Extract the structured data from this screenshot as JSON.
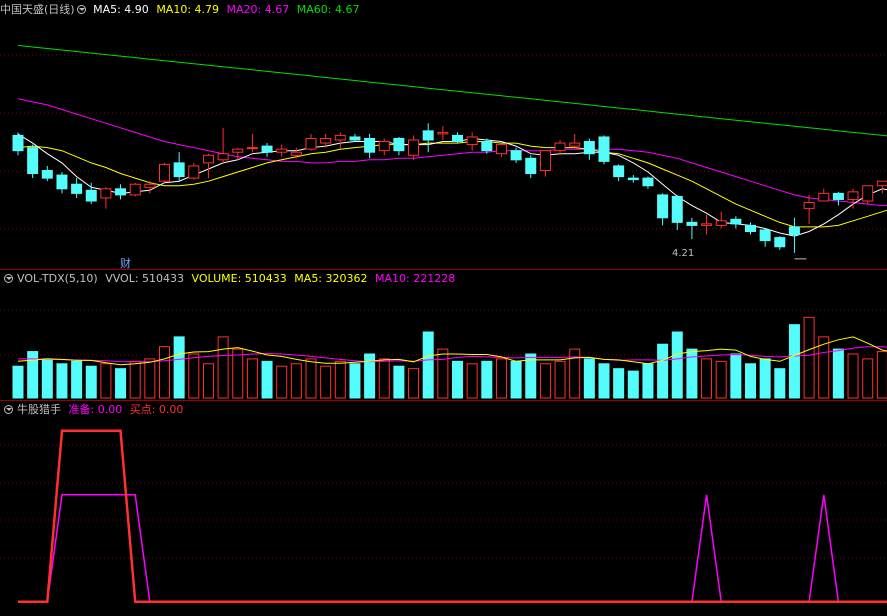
{
  "price_panel": {
    "title": "中国天盛(日线)",
    "indicators": [
      {
        "label": "MA5: 4.90",
        "color": "#ffffff"
      },
      {
        "label": "MA10: 4.79",
        "color": "#ffff00"
      },
      {
        "label": "MA20: 4.67",
        "color": "#ff00ff"
      },
      {
        "label": "MA60: 4.67",
        "color": "#00e000"
      }
    ],
    "finance_marker": "财",
    "low_label": "4.21"
  },
  "volume_panel": {
    "title": "VOL-TDX(5,10)",
    "indicators": [
      {
        "label": "VVOL: 510433",
        "color": "#c0c0c0"
      },
      {
        "label": "VOLUME: 510433",
        "color": "#ffff00"
      },
      {
        "label": "MA5: 320362",
        "color": "#ffff00"
      },
      {
        "label": "MA10: 221228",
        "color": "#ff00ff"
      }
    ]
  },
  "signal_panel": {
    "title": "牛股猎手",
    "indicators": [
      {
        "label": "准备: 0.00",
        "color": "#ff00ff"
      },
      {
        "label": "买点: 0.00",
        "color": "#ff3030"
      }
    ]
  },
  "colors": {
    "up": "#ff3030",
    "down": "#54fcfc",
    "grid": "#7a0000",
    "ma5": "#ffffff",
    "ma10": "#ffff00",
    "ma20": "#ff00ff",
    "ma60": "#00e000"
  },
  "chart_data": [
    {
      "type": "candlestick",
      "title": "中国天盛(日线)",
      "ohlc": [
        [
          4.98,
          5.0,
          4.85,
          4.88
        ],
        [
          4.9,
          4.92,
          4.7,
          4.73
        ],
        [
          4.75,
          4.78,
          4.68,
          4.7
        ],
        [
          4.72,
          4.74,
          4.6,
          4.63
        ],
        [
          4.66,
          4.7,
          4.57,
          4.6
        ],
        [
          4.62,
          4.67,
          4.53,
          4.55
        ],
        [
          4.57,
          4.64,
          4.5,
          4.63
        ],
        [
          4.63,
          4.66,
          4.56,
          4.59
        ],
        [
          4.59,
          4.67,
          4.58,
          4.66
        ],
        [
          4.64,
          4.68,
          4.6,
          4.66
        ],
        [
          4.68,
          4.8,
          4.67,
          4.79
        ],
        [
          4.8,
          4.87,
          4.68,
          4.71
        ],
        [
          4.7,
          4.8,
          4.69,
          4.78
        ],
        [
          4.8,
          4.86,
          4.7,
          4.85
        ],
        [
          4.82,
          5.03,
          4.8,
          4.86
        ],
        [
          4.87,
          4.9,
          4.82,
          4.89
        ],
        [
          4.9,
          4.99,
          4.87,
          4.9
        ],
        [
          4.91,
          4.93,
          4.84,
          4.87
        ],
        [
          4.87,
          4.92,
          4.84,
          4.89
        ],
        [
          4.85,
          4.9,
          4.83,
          4.87
        ],
        [
          4.89,
          4.99,
          4.88,
          4.96
        ],
        [
          4.93,
          4.99,
          4.9,
          4.96
        ],
        [
          4.95,
          5.0,
          4.89,
          4.98
        ],
        [
          4.97,
          4.99,
          4.94,
          4.95
        ],
        [
          4.96,
          4.99,
          4.83,
          4.87
        ],
        [
          4.88,
          4.96,
          4.85,
          4.94
        ],
        [
          4.96,
          4.97,
          4.85,
          4.88
        ],
        [
          4.85,
          4.98,
          4.82,
          4.95
        ],
        [
          5.01,
          5.06,
          4.87,
          4.95
        ],
        [
          4.99,
          5.04,
          4.95,
          5.0
        ],
        [
          4.98,
          5.0,
          4.93,
          4.94
        ],
        [
          4.92,
          5.0,
          4.88,
          4.97
        ],
        [
          4.94,
          4.96,
          4.86,
          4.88
        ],
        [
          4.86,
          4.92,
          4.84,
          4.92
        ],
        [
          4.88,
          4.9,
          4.8,
          4.82
        ],
        [
          4.83,
          4.85,
          4.7,
          4.73
        ],
        [
          4.75,
          4.88,
          4.71,
          4.88
        ],
        [
          4.88,
          4.95,
          4.85,
          4.93
        ],
        [
          4.91,
          4.99,
          4.9,
          4.93
        ],
        [
          4.94,
          4.96,
          4.82,
          4.86
        ],
        [
          4.97,
          4.98,
          4.79,
          4.81
        ],
        [
          4.78,
          4.79,
          4.68,
          4.71
        ],
        [
          4.7,
          4.72,
          4.67,
          4.69
        ],
        [
          4.7,
          4.71,
          4.63,
          4.65
        ],
        [
          4.59,
          4.6,
          4.39,
          4.44
        ],
        [
          4.58,
          4.59,
          4.36,
          4.41
        ],
        [
          4.41,
          4.44,
          4.3,
          4.39
        ],
        [
          4.39,
          4.46,
          4.33,
          4.4
        ],
        [
          4.39,
          4.48,
          4.37,
          4.42
        ],
        [
          4.43,
          4.45,
          4.37,
          4.4
        ],
        [
          4.39,
          4.41,
          4.33,
          4.35
        ],
        [
          4.36,
          4.37,
          4.25,
          4.29
        ],
        [
          4.31,
          4.32,
          4.23,
          4.25
        ],
        [
          4.38,
          4.44,
          4.21,
          4.33
        ],
        [
          4.5,
          4.59,
          4.4,
          4.54
        ],
        [
          4.55,
          4.63,
          4.55,
          4.6
        ],
        [
          4.6,
          4.61,
          4.52,
          4.56
        ],
        [
          4.56,
          4.63,
          4.5,
          4.61
        ],
        [
          4.55,
          4.65,
          4.53,
          4.65
        ],
        [
          4.65,
          4.68,
          4.6,
          4.68
        ],
        [
          4.67,
          4.69,
          4.55,
          4.55
        ],
        [
          4.56,
          4.62,
          4.53,
          4.6
        ],
        [
          4.59,
          4.61,
          4.56,
          4.57
        ],
        [
          4.55,
          4.62,
          4.53,
          4.6
        ],
        [
          4.58,
          4.63,
          4.57,
          4.62
        ],
        [
          4.62,
          4.65,
          4.58,
          4.6
        ],
        [
          4.61,
          4.63,
          4.54,
          4.63
        ],
        [
          4.6,
          4.66,
          4.58,
          4.63
        ],
        [
          4.63,
          4.65,
          4.56,
          4.56
        ],
        [
          4.56,
          4.64,
          4.55,
          4.63
        ],
        [
          4.63,
          4.66,
          4.58,
          4.59
        ],
        [
          4.58,
          4.64,
          4.55,
          4.64
        ],
        [
          4.64,
          4.66,
          4.58,
          4.62
        ],
        [
          4.62,
          4.65,
          4.55,
          4.58
        ]
      ],
      "ma5": [
        4.99,
        4.93,
        4.86,
        4.8,
        4.71,
        4.64,
        4.62,
        4.6,
        4.61,
        4.62,
        4.67,
        4.68,
        4.72,
        4.76,
        4.8,
        4.82,
        4.86,
        4.87,
        4.88,
        4.88,
        4.9,
        4.91,
        4.93,
        4.94,
        4.94,
        4.94,
        4.92,
        4.92,
        4.92,
        4.94,
        4.94,
        4.96,
        4.95,
        4.94,
        4.91,
        4.86,
        4.85,
        4.86,
        4.86,
        4.87,
        4.87,
        4.85,
        4.8,
        4.74,
        4.66,
        4.58,
        4.52,
        4.47,
        4.41,
        4.4,
        4.39,
        4.37,
        4.34,
        4.32,
        4.35,
        4.4,
        4.46,
        4.53,
        4.59,
        4.63,
        4.61,
        4.6,
        4.59,
        4.6,
        4.59,
        4.6,
        4.6,
        4.61,
        4.61,
        4.61,
        4.61,
        4.61,
        4.61,
        4.61
      ],
      "ma10": [
        4.9,
        4.91,
        4.9,
        4.88,
        4.84,
        4.8,
        4.77,
        4.73,
        4.7,
        4.67,
        4.65,
        4.65,
        4.66,
        4.68,
        4.71,
        4.74,
        4.77,
        4.8,
        4.82,
        4.84,
        4.86,
        4.87,
        4.89,
        4.9,
        4.91,
        4.92,
        4.92,
        4.92,
        4.93,
        4.93,
        4.93,
        4.94,
        4.94,
        4.93,
        4.93,
        4.91,
        4.9,
        4.9,
        4.9,
        4.89,
        4.87,
        4.86,
        4.83,
        4.8,
        4.76,
        4.72,
        4.68,
        4.63,
        4.58,
        4.53,
        4.49,
        4.45,
        4.41,
        4.38,
        4.38,
        4.38,
        4.39,
        4.42,
        4.45,
        4.48,
        4.51,
        4.53,
        4.56,
        4.58,
        4.59,
        4.6,
        4.6,
        4.6,
        4.6,
        4.6,
        4.61,
        4.61,
        4.61,
        4.61
      ],
      "ma20": [
        5.22,
        5.2,
        5.18,
        5.15,
        5.12,
        5.09,
        5.06,
        5.03,
        5.0,
        4.97,
        4.94,
        4.92,
        4.9,
        4.88,
        4.86,
        4.84,
        4.83,
        4.82,
        4.81,
        4.81,
        4.8,
        4.8,
        4.81,
        4.81,
        4.82,
        4.82,
        4.83,
        4.83,
        4.84,
        4.85,
        4.86,
        4.87,
        4.87,
        4.88,
        4.88,
        4.88,
        4.88,
        4.89,
        4.89,
        4.89,
        4.89,
        4.89,
        4.88,
        4.87,
        4.85,
        4.83,
        4.8,
        4.77,
        4.74,
        4.71,
        4.68,
        4.65,
        4.62,
        4.59,
        4.57,
        4.56,
        4.55,
        4.54,
        4.53,
        4.52,
        4.52,
        4.51,
        4.51,
        4.51,
        4.51,
        4.51,
        4.51,
        4.51,
        4.52,
        4.52,
        4.52,
        4.53,
        4.54,
        4.54
      ],
      "ma60": [
        5.57,
        5.56,
        5.55,
        5.54,
        5.53,
        5.52,
        5.51,
        5.5,
        5.49,
        5.48,
        5.47,
        5.46,
        5.45,
        5.44,
        5.43,
        5.42,
        5.41,
        5.4,
        5.39,
        5.38,
        5.37,
        5.36,
        5.35,
        5.34,
        5.33,
        5.32,
        5.31,
        5.3,
        5.29,
        5.28,
        5.27,
        5.26,
        5.25,
        5.24,
        5.23,
        5.22,
        5.21,
        5.2,
        5.19,
        5.18,
        5.17,
        5.16,
        5.15,
        5.14,
        5.13,
        5.12,
        5.11,
        5.1,
        5.09,
        5.08,
        5.07,
        5.06,
        5.05,
        5.04,
        5.03,
        5.02,
        5.01,
        5.0,
        4.99,
        4.98,
        4.97,
        4.96,
        4.95,
        4.94,
        4.93,
        4.92,
        4.91,
        4.9,
        4.89,
        4.88,
        4.87,
        4.86,
        4.85,
        4.84
      ],
      "ylim": [
        4.15,
        5.75
      ],
      "low_point": {
        "index": 53,
        "value": 4.21
      },
      "finance_marker_index": 10
    },
    {
      "type": "bar",
      "title": "VOL-TDX(5,10)",
      "volume": [
        130000,
        190000,
        160000,
        140000,
        150000,
        130000,
        140000,
        120000,
        150000,
        160000,
        210000,
        250000,
        180000,
        140000,
        250000,
        200000,
        160000,
        150000,
        130000,
        140000,
        160000,
        130000,
        150000,
        140000,
        180000,
        160000,
        130000,
        120000,
        270000,
        200000,
        150000,
        140000,
        150000,
        160000,
        150000,
        180000,
        140000,
        150000,
        200000,
        160000,
        140000,
        120000,
        110000,
        140000,
        220000,
        270000,
        200000,
        160000,
        150000,
        180000,
        140000,
        160000,
        120000,
        300000,
        330000,
        250000,
        200000,
        180000,
        160000,
        190000,
        200000,
        170000,
        150000,
        130000,
        160000,
        150000,
        140000,
        150000,
        160000,
        150000,
        140000,
        130000,
        120000,
        130000
      ],
      "ma5": [
        150000,
        155000,
        160000,
        158000,
        154000,
        154000,
        144000,
        136000,
        140000,
        146000,
        160000,
        180000,
        188000,
        190000,
        200000,
        206000,
        192000,
        176000,
        170000,
        158000,
        148000,
        142000,
        142000,
        146000,
        150000,
        156000,
        158000,
        148000,
        172000,
        180000,
        180000,
        178000,
        178000,
        168000,
        150000,
        156000,
        156000,
        156000,
        164000,
        166000,
        158000,
        156000,
        148000,
        140000,
        154000,
        180000,
        190000,
        194000,
        200000,
        196000,
        170000,
        158000,
        150000,
        174000,
        198000,
        220000,
        238000,
        250000,
        224000,
        196000,
        186000,
        182000,
        176000,
        166000,
        160000,
        156000,
        150000,
        146000,
        150000,
        152000,
        150000,
        146000,
        142000,
        138000
      ],
      "ma10": [
        160000,
        160000,
        158000,
        157000,
        156000,
        154000,
        152000,
        149000,
        148000,
        148000,
        152000,
        158000,
        165000,
        170000,
        174000,
        176000,
        180000,
        182000,
        180000,
        176000,
        170000,
        164000,
        158000,
        152000,
        149000,
        150000,
        152000,
        150000,
        156000,
        158000,
        166000,
        170000,
        168000,
        166000,
        164000,
        166000,
        166000,
        166000,
        168000,
        166000,
        158000,
        154000,
        156000,
        156000,
        154000,
        160000,
        168000,
        172000,
        176000,
        178000,
        175000,
        170000,
        168000,
        172000,
        175000,
        186000,
        194000,
        204000,
        210000,
        210000,
        205000,
        200000,
        195000,
        190000,
        185000,
        175000,
        168000,
        164000,
        158000,
        156000,
        153000,
        150000,
        148000,
        146000
      ],
      "ylim": [
        0,
        450000
      ]
    },
    {
      "type": "line",
      "title": "牛股猎手",
      "series": [
        {
          "name": "准备",
          "color": "#ff00ff",
          "values": [
            0,
            0,
            0,
            1,
            1,
            1,
            1,
            1,
            1,
            0,
            0,
            0,
            0,
            0,
            0,
            0,
            0,
            0,
            0,
            0,
            0,
            0,
            0,
            0,
            0,
            0,
            0,
            0,
            0,
            0,
            0,
            0,
            0,
            0,
            0,
            0,
            0,
            0,
            0,
            0,
            0,
            0,
            0,
            0,
            0,
            0,
            0,
            1,
            0,
            0,
            0,
            0,
            0,
            0,
            0,
            1,
            0,
            0,
            0,
            0,
            0,
            0,
            0,
            0,
            0,
            0,
            0,
            0,
            0,
            0,
            0,
            0,
            0,
            0
          ]
        },
        {
          "name": "买点",
          "color": "#ff3030",
          "values": [
            0,
            0,
            0,
            1.6,
            1.6,
            1.6,
            1.6,
            1.6,
            0,
            0,
            0,
            0,
            0,
            0,
            0,
            0,
            0,
            0,
            0,
            0,
            0,
            0,
            0,
            0,
            0,
            0,
            0,
            0,
            0,
            0,
            0,
            0,
            0,
            0,
            0,
            0,
            0,
            0,
            0,
            0,
            0,
            0,
            0,
            0,
            0,
            0,
            0,
            0,
            0,
            0,
            0,
            0,
            0,
            0,
            0,
            0,
            0,
            0,
            0,
            0,
            0,
            0,
            0,
            0,
            0,
            0,
            0,
            0,
            0,
            0,
            0,
            0,
            0,
            0
          ]
        }
      ],
      "ylim": [
        -0.05,
        1.7
      ]
    }
  ]
}
